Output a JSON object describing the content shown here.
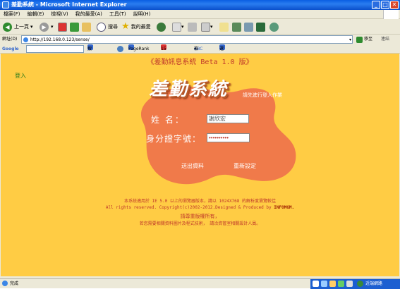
{
  "window": {
    "title": "差勤系統 - Microsoft Internet Explorer"
  },
  "menu": [
    "檔案(F)",
    "編輯(E)",
    "檢視(V)",
    "我的最愛(A)",
    "工具(T)",
    "說明(H)"
  ],
  "toolbar": {
    "back": "上一頁",
    "search": "搜尋",
    "favorites": "我的最愛"
  },
  "address": {
    "label": "網址(D)",
    "url": "http://192.168.0.123/sense/",
    "go": "移至",
    "links": "連結"
  },
  "google": {
    "label": "Google",
    "search": "搜尋",
    "pagerank": "PageRank",
    "blocked": "15 已攔截",
    "check": "檢查",
    "options": "選項"
  },
  "page": {
    "system_title": "《差勤訊息系統 Beta 1.0 版》",
    "login_link": "登入",
    "logo": "差勤系統",
    "subtitle": "請先進行登入作業",
    "name_label": "姓 名：",
    "name_value": "謝欣宏",
    "id_label": "身分證字號：",
    "id_value": "••••••••••",
    "submit": "送出資料",
    "reset": "重新設定",
    "foot1": "本系統適用於 IE 5.0 以上的瀏覽器版本，請以 1024X768 的解析度瀏覽較佳",
    "foot2a": "All rights reserved. Copyright(c)2002-2012.Designed & Produced by ",
    "foot2b": "INFOMGM.",
    "foot3": "請尊重版權所有，",
    "foot4": "若您需要相關資料圖片及程式技術， 請洽資管室相關設計人員。"
  },
  "status": {
    "left": "完成",
    "right": "近端網路"
  }
}
